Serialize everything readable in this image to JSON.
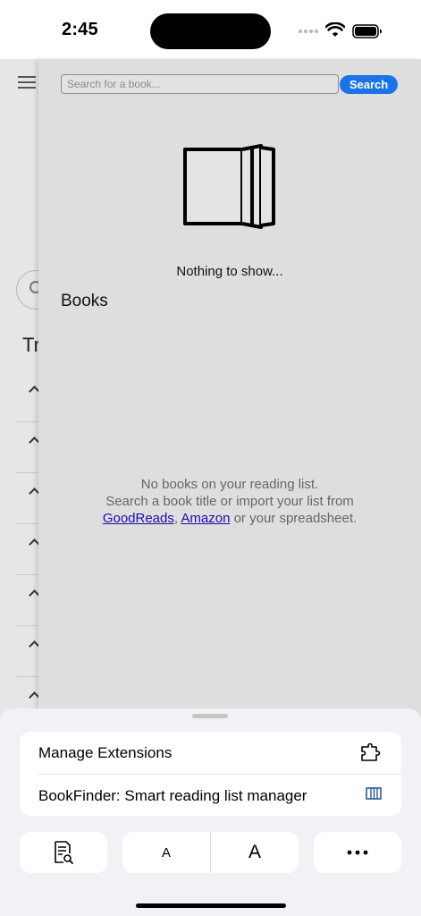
{
  "status_bar": {
    "time": "2:45"
  },
  "underlay": {
    "heading": "Tr"
  },
  "extension": {
    "search": {
      "placeholder": "Search for a book...",
      "button_label": "Search"
    },
    "nothing_text": "Nothing to show...",
    "books_heading": "Books",
    "empty": {
      "line1": "No books on your reading list.",
      "line2": "Search a book title or import your list from",
      "link_goodreads": "GoodReads",
      "separator": ",",
      "link_amazon": "Amazon",
      "line3_suffix": "or your spreadsheet."
    }
  },
  "sheet": {
    "menu_items": [
      {
        "label": "Manage Extensions",
        "icon": "puzzle-icon"
      },
      {
        "label": "BookFinder: Smart reading list manager",
        "icon": "bookfinder-icon"
      }
    ],
    "toolbar": {
      "reader_icon": "reader-search-icon",
      "font_small": "A",
      "font_large": "A",
      "more_icon": "ellipsis-icon"
    }
  },
  "colors": {
    "accent": "#1a73e8",
    "link": "#1a0dab",
    "panel_bg": "#dedede",
    "sheet_bg": "#f2f2f6"
  }
}
